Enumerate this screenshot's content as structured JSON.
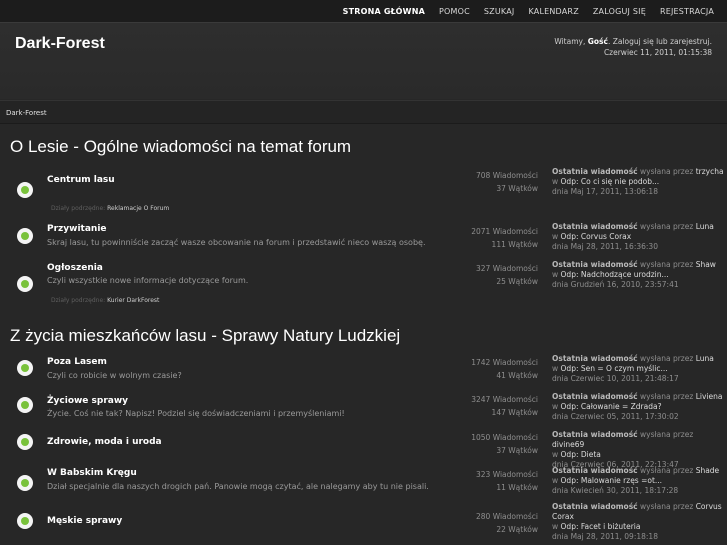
{
  "nav": {
    "items": [
      "STRONA GŁÓWNA",
      "POMOC",
      "SZUKAJ",
      "KALENDARZ",
      "ZALOGUJ SIĘ",
      "REJESTRACJA"
    ]
  },
  "header": {
    "site_title": "Dark-Forest",
    "welcome_prefix": "Witamy, ",
    "guest": "Gość",
    "welcome_suffix": ". Zaloguj się lub zarejestruj.",
    "datetime": "Czerwiec 11, 2011, 01:15:38"
  },
  "breadcrumb": "Dark-Forest",
  "categories": [
    {
      "title": "O Lesie - Ogólne wiadomości na temat forum",
      "boards": [
        {
          "name": "Centrum lasu",
          "desc": "",
          "subs_label": "Działy podrzędne:",
          "subs": "Reklamacje  O Forum",
          "posts": "708 Wiadomości",
          "topics": "37 Wątków",
          "last_label": "Ostatnia wiadomość",
          "last_by": "wysłana przez",
          "last_user": "trzycha",
          "last_topic_prefix": "w",
          "last_topic": "Odp: Co ci się nie podob...",
          "last_date": "dnia Maj 17, 2011, 13:06:18"
        },
        {
          "name": "Przywitanie",
          "desc": "Skraj lasu, tu powinniście zacząć wasze obcowanie na forum i przedstawić nieco waszą osobę.",
          "posts": "2071 Wiadomości",
          "topics": "111 Wątków",
          "last_label": "Ostatnia wiadomość",
          "last_by": "wysłana przez",
          "last_user": "Luna",
          "last_topic_prefix": "w",
          "last_topic": "Odp: Corvus Corax",
          "last_date": "dnia Maj 28, 2011, 16:36:30"
        },
        {
          "name": "Ogłoszenia",
          "desc": "Czyli wszystkie nowe informacje dotyczące forum.",
          "subs_label": "Działy podrzędne:",
          "subs": "Kurier DarkForest",
          "posts": "327 Wiadomości",
          "topics": "25 Wątków",
          "last_label": "Ostatnia wiadomość",
          "last_by": "wysłana przez",
          "last_user": "Shaw",
          "last_topic_prefix": "w",
          "last_topic": "Odp: Nadchodzące urodzin...",
          "last_date": "dnia Grudzień 16, 2010, 23:57:41"
        }
      ]
    },
    {
      "title": "Z życia mieszkańców lasu - Sprawy Natury Ludzkiej",
      "boards": [
        {
          "name": "Poza Lasem",
          "desc": "Czyli co robicie w wolnym czasie?",
          "posts": "1742 Wiadomości",
          "topics": "41 Wątków",
          "last_label": "Ostatnia wiadomość",
          "last_by": "wysłana przez",
          "last_user": "Luna",
          "last_topic_prefix": "w",
          "last_topic": "Odp: Sen = O czym myślic...",
          "last_date": "dnia Czerwiec 10, 2011, 21:48:17"
        },
        {
          "name": "Życiowe sprawy",
          "desc": "Życie. Coś nie tak? Napisz! Podziel się doświadczeniami i przemyśleniami!",
          "posts": "3247 Wiadomości",
          "topics": "147 Wątków",
          "last_label": "Ostatnia wiadomość",
          "last_by": "wysłana przez",
          "last_user": "Liviena",
          "last_topic_prefix": "w",
          "last_topic": "Odp: Całowanie = Zdrada?",
          "last_date": "dnia Czerwiec 05, 2011, 17:30:02"
        },
        {
          "name": "Zdrowie, moda i uroda",
          "desc": "",
          "posts": "1050 Wiadomości",
          "topics": "37 Wątków",
          "last_label": "Ostatnia wiadomość",
          "last_by": "wysłana przez",
          "last_user": "divine69",
          "last_topic_prefix": "w",
          "last_topic": "Odp: Dieta",
          "last_date": "dnia Czerwiec 06, 2011, 22:13:47"
        },
        {
          "name": "W Babskim Kręgu",
          "desc": "Dział specjalnie dla naszych drogich pań. Panowie mogą czytać, ale nalegamy aby tu nie pisali.",
          "posts": "323 Wiadomości",
          "topics": "11 Wątków",
          "last_label": "Ostatnia wiadomość",
          "last_by": "wysłana przez",
          "last_user": "Shade",
          "last_topic_prefix": "w",
          "last_topic": "Odp: Malowanie rzęs =ot...",
          "last_date": "dnia Kwiecień 30, 2011, 18:17:28"
        },
        {
          "name": "Męskie sprawy",
          "desc": "",
          "posts": "280 Wiadomości",
          "topics": "22 Wątków",
          "last_label": "Ostatnia wiadomość",
          "last_by": "wysłana przez",
          "last_user": "Corvus Corax",
          "last_topic_prefix": "w",
          "last_topic": "Odp: Facet i biżuteria",
          "last_date": "dnia Maj 28, 2011, 09:18:18"
        }
      ]
    }
  ]
}
